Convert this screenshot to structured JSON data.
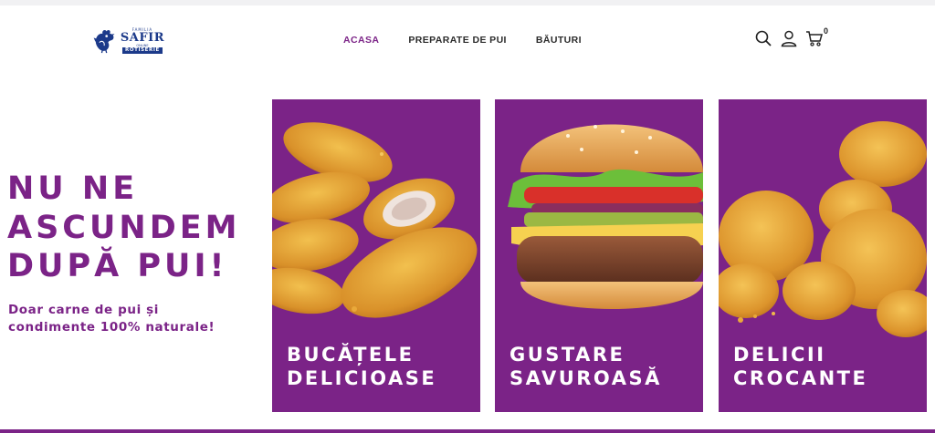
{
  "brand": {
    "family_label": "FAMILIA",
    "name": "SAFIR",
    "since_label": "ONLINE",
    "tagline": "ROTISERIE"
  },
  "nav": {
    "items": [
      {
        "label": "ACASA",
        "active": true
      },
      {
        "label": "PREPARATE DE PUI",
        "active": false
      },
      {
        "label": "BĂUTURI",
        "active": false
      }
    ]
  },
  "header_icons": {
    "search": "search-icon",
    "account": "user-icon",
    "cart": "cart-icon",
    "cart_count": "0"
  },
  "hero": {
    "title_lines": [
      "NU NE",
      "ASCUNDEM",
      "DUPĂ PUI!"
    ],
    "subtitle_lines": [
      "Doar carne de pui și",
      "condimente 100% naturale!"
    ]
  },
  "cards": [
    {
      "caption_lines": [
        "BUCĂȚELE",
        "DELICIOASE"
      ],
      "image": "chicken-tenders"
    },
    {
      "caption_lines": [
        "GUSTARE",
        "SAVUROASĂ"
      ],
      "image": "chicken-burger"
    },
    {
      "caption_lines": [
        "DELICII",
        "CROCANTE"
      ],
      "image": "crispy-chicken-pieces"
    }
  ],
  "colors": {
    "accent": "#7b2387",
    "brand_blue": "#1c3a8a",
    "text_dark": "#2b2b2b",
    "card_text": "#ffffff"
  }
}
